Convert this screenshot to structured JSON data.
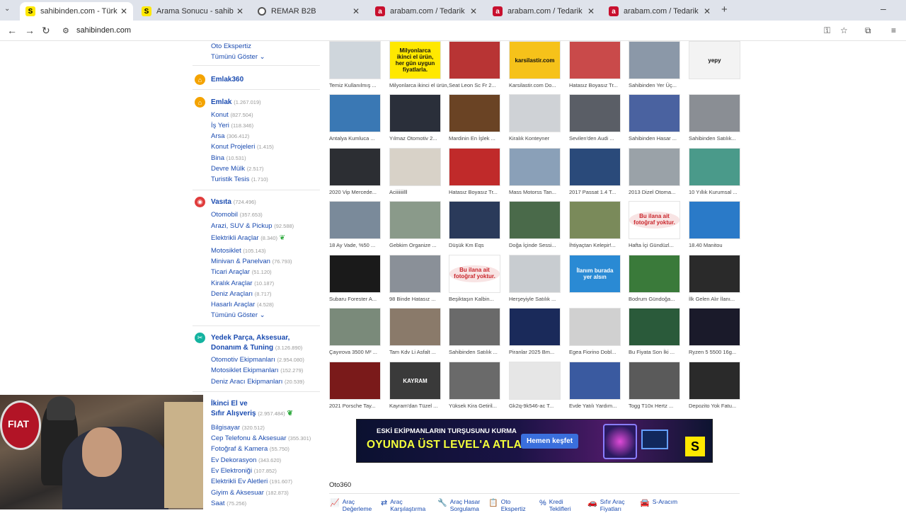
{
  "browser": {
    "tabs": [
      {
        "title": "sahibinden.com - Türkiye'nin O",
        "favicon": "s"
      },
      {
        "title": "Arama Sonucu - sahibinden.co",
        "favicon": "s"
      },
      {
        "title": "REMAR B2B",
        "favicon": "r"
      },
      {
        "title": "arabam.com / Tedarik",
        "favicon": "a"
      },
      {
        "title": "arabam.com / Tedarik",
        "favicon": "a"
      },
      {
        "title": "arabam.com / Tedarik",
        "favicon": "a"
      }
    ],
    "new_tab_icon": "+",
    "minimize_icon": "–",
    "url": "sahibinden.com",
    "favicon_letter": "S"
  },
  "sidebar": {
    "top_links": {
      "oto_ekspertiz": "Oto Ekspertiz",
      "tumunu_goster": "Tümünü Göster"
    },
    "emlak360": "Emlak360",
    "emlak": {
      "title": "Emlak",
      "count": "(1.267.019)",
      "items": [
        {
          "label": "Konut",
          "count": "(827.504)"
        },
        {
          "label": "İş Yeri",
          "count": "(118.346)"
        },
        {
          "label": "Arsa",
          "count": "(306.412)"
        },
        {
          "label": "Konut Projeleri",
          "count": "(1.415)"
        },
        {
          "label": "Bina",
          "count": "(10.531)"
        },
        {
          "label": "Devre Mülk",
          "count": "(2.517)"
        },
        {
          "label": "Turistik Tesis",
          "count": "(1.710)"
        }
      ]
    },
    "vasita": {
      "title": "Vasıta",
      "count": "(724.496)",
      "items": [
        {
          "label": "Otomobil",
          "count": "(357.653)"
        },
        {
          "label": "Arazi, SUV & Pickup",
          "count": "(92.588)"
        },
        {
          "label": "Elektrikli Araçlar",
          "count": "(8.340)"
        },
        {
          "label": "Motosiklet",
          "count": "(105.143)"
        },
        {
          "label": "Minivan & Panelvan",
          "count": "(76.793)"
        },
        {
          "label": "Ticari Araçlar",
          "count": "(51.120)"
        },
        {
          "label": "Kiralık Araçlar",
          "count": "(10.187)"
        },
        {
          "label": "Deniz Araçları",
          "count": "(8.717)"
        },
        {
          "label": "Hasarlı Araçlar",
          "count": "(4.528)"
        }
      ],
      "show_all": "Tümünü Göster"
    },
    "yedek": {
      "title1": "Yedek Parça, Aksesuar,",
      "title2": "Donanım & Tuning",
      "count": "(3.126.890)",
      "items": [
        {
          "label": "Otomotiv Ekipmanları",
          "count": "(2.954.080)"
        },
        {
          "label": "Motosiklet Ekipmanları",
          "count": "(152.279)"
        },
        {
          "label": "Deniz Aracı Ekipmanları",
          "count": "(20.539)"
        }
      ]
    },
    "ikinci_el": {
      "title1": "İkinci El ve",
      "title2": "Sıfır Alışveriş",
      "count": "(2.957.484)",
      "items": [
        {
          "label": "Bilgisayar",
          "count": "(320.512)"
        },
        {
          "label": "Cep Telefonu & Aksesuar",
          "count": "(355.301)"
        },
        {
          "label": "Fotoğraf & Kamera",
          "count": "(55.750)"
        },
        {
          "label": "Ev Dekorasyon",
          "count": "(343.620)"
        },
        {
          "label": "Ev Elektroniği",
          "count": "(107.852)"
        },
        {
          "label": "Elektrikli Ev Aletleri",
          "count": "(191.607)"
        },
        {
          "label": "Giyim & Aksesuar",
          "count": "(182.873)"
        },
        {
          "label": "Saat",
          "count": "(75.256)"
        }
      ]
    }
  },
  "listings": [
    {
      "caption": "Temiz Kullanılmış ...",
      "bg": "#cfd6dc",
      "text": ""
    },
    {
      "caption": "Milyonlarca ikinci el ürün, her gün uygun fiyatlarla.",
      "bg": "#ffe800",
      "text": "Milyonlarca ikinci el ürün, her gün uygun fiyatlarla."
    },
    {
      "caption": "Seat Leon Sc Fr 2...",
      "bg": "#b83434",
      "text": ""
    },
    {
      "caption": "Karsilastir.com Do...",
      "bg": "#f6c21a",
      "text": "karsilastir.com"
    },
    {
      "caption": "Hatasız Boyasız Tr...",
      "bg": "#c94a4a",
      "text": ""
    },
    {
      "caption": "Sahibinden Yer Üç...",
      "bg": "#8b98a8",
      "text": ""
    },
    {
      "caption": "",
      "bg": "#f3f3f3",
      "text": "yepy"
    },
    {
      "caption": "Antalya Kumluca ...",
      "bg": "#3a78b4",
      "text": ""
    },
    {
      "caption": "Yılmaz Otomotiv 2...",
      "bg": "#2a2f3a",
      "text": ""
    },
    {
      "caption": "Mardinin En İşlek ...",
      "bg": "#6a4324",
      "text": ""
    },
    {
      "caption": "Kiralık Konteyner",
      "bg": "#cfd2d6",
      "text": ""
    },
    {
      "caption": "Sevilen'den Audi ...",
      "bg": "#5a5e66",
      "text": ""
    },
    {
      "caption": "Sahibinden Hasar ...",
      "bg": "#4a62a0",
      "text": ""
    },
    {
      "caption": "Sahibinden Satılık...",
      "bg": "#8a8e94",
      "text": ""
    },
    {
      "caption": "2020 Vip Mercede...",
      "bg": "#2c2e33",
      "text": ""
    },
    {
      "caption": "Aciiiiiiilll",
      "bg": "#d8d2c8",
      "text": ""
    },
    {
      "caption": "Hatasız Boyasız Tr...",
      "bg": "#c02a2a",
      "text": ""
    },
    {
      "caption": "Mass Motorss Tan...",
      "bg": "#8aa0b8",
      "text": ""
    },
    {
      "caption": "2017 Passat 1.4 T...",
      "bg": "#2a4a7a",
      "text": ""
    },
    {
      "caption": "2013 Dizel Otoma...",
      "bg": "#9aa2a8",
      "text": ""
    },
    {
      "caption": "10 Yıllık Kurumsal ...",
      "bg": "#4a9a8a",
      "text": ""
    },
    {
      "caption": "18 Ay Vade, %50 ...",
      "bg": "#7a8a9a",
      "text": ""
    },
    {
      "caption": "Gebkim Organize ...",
      "bg": "#8a9a8a",
      "text": ""
    },
    {
      "caption": "Düşük Km Eqs",
      "bg": "#2a3a5a",
      "text": ""
    },
    {
      "caption": "Doğa İçinde Sessi...",
      "bg": "#4a6a4a",
      "text": ""
    },
    {
      "caption": "İhtiyaçtan Kelepir!...",
      "bg": "#7a8a5a",
      "text": ""
    },
    {
      "caption": "Hafta İçi Gündüzl...",
      "bg": "#ffffff",
      "text": "Bu ilana ait fotoğraf yoktur."
    },
    {
      "caption": "18.40 Manitou",
      "bg": "#2a7ac8",
      "text": ""
    },
    {
      "caption": "Subaru Forester A...",
      "bg": "#1a1a1a",
      "text": ""
    },
    {
      "caption": "98 Binde Hatasız ...",
      "bg": "#8a9098",
      "text": ""
    },
    {
      "caption": "Beşiktaşın Kalbin...",
      "bg": "#ffffff",
      "text": "Bu ilana ait fotoğraf yoktur."
    },
    {
      "caption": "Herşeyiyle Satılık ...",
      "bg": "#c8ccd0",
      "text": ""
    },
    {
      "caption": "",
      "bg": "#2a8ad4",
      "text": "İlanım burada yer alsın"
    },
    {
      "caption": "Bodrum Gündoğa...",
      "bg": "#3a7a3a",
      "text": ""
    },
    {
      "caption": "İlk Gelen Alır İlanı...",
      "bg": "#2a2a2a",
      "text": ""
    },
    {
      "caption": "Çayırova 3500 M² ...",
      "bg": "#7a8a7a",
      "text": ""
    },
    {
      "caption": "Tam Kdv Li Asfalt ...",
      "bg": "#8a7a6a",
      "text": ""
    },
    {
      "caption": "Sahibinden Satılık ...",
      "bg": "#6a6a6a",
      "text": ""
    },
    {
      "caption": "Piranlar 2025 Bm...",
      "bg": "#1a2a5a",
      "text": ""
    },
    {
      "caption": "Egea Fiorino Dobl...",
      "bg": "#d0d0d0",
      "text": ""
    },
    {
      "caption": "Bu Fiyata Son İki ...",
      "bg": "#2a5a3a",
      "text": ""
    },
    {
      "caption": "Ryzen 5 5500 16g...",
      "bg": "#1a1a2a",
      "text": ""
    },
    {
      "caption": "2021 Porsche Tay...",
      "bg": "#7a1a1a",
      "text": ""
    },
    {
      "caption": "Kayram'dan Tüzel ...",
      "bg": "#3a3a3a",
      "text": "KAYRAM"
    },
    {
      "caption": "Yüksek Kira Getiril...",
      "bg": "#6a6a6a",
      "text": ""
    },
    {
      "caption": "Gk2q-9k546-ac T...",
      "bg": "#e6e6e6",
      "text": ""
    },
    {
      "caption": "Evde Yatılı Yardım...",
      "bg": "#3a5aa0",
      "text": ""
    },
    {
      "caption": "Togg T10x Hertz ...",
      "bg": "#5a5a5a",
      "text": ""
    },
    {
      "caption": "Depozito Yok Fatu...",
      "bg": "#2a2a2a",
      "text": ""
    }
  ],
  "banner": {
    "line1": "ESKİ EKİPMANLARIN TURŞUSUNU KURMA",
    "line2": "OYUNDA ÜST LEVEL'A ATLA!",
    "button": "Hemen keşfet",
    "logo": "S"
  },
  "oto360": {
    "title": "Oto360",
    "items": [
      {
        "label": "Araç\nDeğerleme",
        "icon": "chart-icon"
      },
      {
        "label": "Araç\nKarşılaştırma",
        "icon": "arrows-icon"
      },
      {
        "label": "Araç Hasar\nSorgulama",
        "icon": "wrench-icon"
      },
      {
        "label": "Oto\nEkspertiz",
        "icon": "clipboard-icon"
      },
      {
        "label": "Kredi\nTeklifleri",
        "icon": "percent-icon"
      },
      {
        "label": "Sıfır Araç\nFiyatları",
        "icon": "car-icon"
      },
      {
        "label": "S-Aracım",
        "icon": "s-car-icon"
      }
    ]
  },
  "colors": {
    "link": "#1a4bb0",
    "emlak": "#f4a300",
    "vasita": "#e03c3c",
    "yedek": "#14b3a0",
    "ikinci": "#4a7ac8",
    "brand": "#ffe800"
  }
}
